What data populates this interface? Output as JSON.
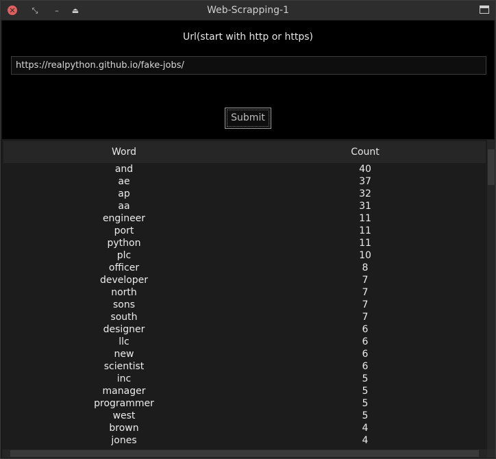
{
  "window": {
    "title": "Web-Scrapping-1",
    "close_glyph": "✕",
    "restore_glyph": "⤡",
    "min_glyph": "–",
    "shade_glyph": "⏏"
  },
  "form": {
    "url_label": "Url(start with http or https)",
    "url_value": "https://realpython.github.io/fake-jobs/",
    "submit_label": "Submit"
  },
  "table": {
    "headers": [
      "Word",
      "Count"
    ],
    "rows": [
      [
        "and",
        "40"
      ],
      [
        "ae",
        "37"
      ],
      [
        "ap",
        "32"
      ],
      [
        "aa",
        "31"
      ],
      [
        "engineer",
        "11"
      ],
      [
        "port",
        "11"
      ],
      [
        "python",
        "11"
      ],
      [
        "plc",
        "10"
      ],
      [
        "officer",
        "8"
      ],
      [
        "developer",
        "7"
      ],
      [
        "north",
        "7"
      ],
      [
        "sons",
        "7"
      ],
      [
        "south",
        "7"
      ],
      [
        "designer",
        "6"
      ],
      [
        "llc",
        "6"
      ],
      [
        "new",
        "6"
      ],
      [
        "scientist",
        "6"
      ],
      [
        "inc",
        "5"
      ],
      [
        "manager",
        "5"
      ],
      [
        "programmer",
        "5"
      ],
      [
        "west",
        "5"
      ],
      [
        "brown",
        "4"
      ],
      [
        "jones",
        "4"
      ]
    ]
  },
  "colors": {
    "close_button": "#e05f5f",
    "panel_bg": "#000000",
    "table_bg": "#1c1c1c"
  }
}
